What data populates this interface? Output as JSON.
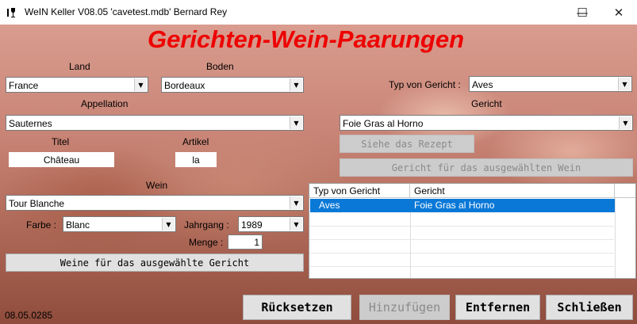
{
  "window": {
    "title": "WeIN Keller V08.05  'cavetest.mdb'   Bernard Rey",
    "minimize": "—",
    "maximize": "☐",
    "close": "✕"
  },
  "heading": "Gerichten-Wein-Paarungen",
  "left": {
    "land_label": "Land",
    "land_value": "France",
    "boden_label": "Boden",
    "boden_value": "Bordeaux",
    "appellation_label": "Appellation",
    "appellation_value": "Sauternes",
    "titel_label": "Titel",
    "titel_value": "Château",
    "artikel_label": "Artikel",
    "artikel_value": "la",
    "wein_label": "Wein",
    "wein_value": "Tour Blanche",
    "farbe_label": "Farbe :",
    "farbe_value": "Blanc",
    "jahrgang_label": "Jahrgang :",
    "jahrgang_value": "1989",
    "menge_label": "Menge :",
    "menge_value": "1",
    "weine_button": "Weine für das ausgewählte Gericht"
  },
  "right": {
    "typ_label": "Typ von Gericht :",
    "typ_value": "Aves",
    "gericht_label": "Gericht",
    "gericht_value": "Foie Gras al Horno",
    "rezept_button": "Siehe das Rezept",
    "gericht_wein_button": "Gericht für das ausgewählten Wein"
  },
  "table": {
    "columns": [
      "Typ von Gericht",
      "Gericht"
    ],
    "rows": [
      {
        "typ": "Aves",
        "gericht": "Foie Gras al Horno"
      }
    ]
  },
  "footer": {
    "version": "08.05.0285",
    "reset_button": "Rücksetzen",
    "add_button": "Hinzufügen",
    "remove_button": "Entfernen",
    "close_button": "Schließen"
  },
  "icons": {
    "dropdown": "chevron-down-icon",
    "app": "wine-keller-app-icon"
  },
  "colors": {
    "heading": "#ee0000",
    "selection": "#0a78d7"
  }
}
